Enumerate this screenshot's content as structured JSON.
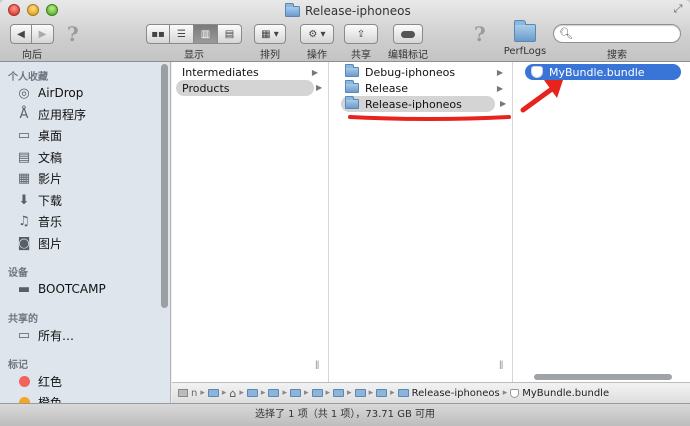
{
  "window": {
    "title": "Release-iphoneos"
  },
  "toolbar": {
    "back_label": "向后",
    "view_label": "显示",
    "arrange_label": "排列",
    "action_label": "操作",
    "share_label": "共享",
    "edit_tags_label": "编辑标记",
    "perflogs_label": "PerfLogs",
    "search_label": "搜索",
    "search_placeholder": ""
  },
  "sidebar": {
    "favorites_header": "个人收藏",
    "favorites": [
      {
        "label": "AirDrop",
        "icon": "airdrop-icon"
      },
      {
        "label": "应用程序",
        "icon": "applications-icon"
      },
      {
        "label": "桌面",
        "icon": "desktop-icon"
      },
      {
        "label": "文稿",
        "icon": "documents-icon"
      },
      {
        "label": "影片",
        "icon": "movies-icon"
      },
      {
        "label": "下载",
        "icon": "downloads-icon"
      },
      {
        "label": "音乐",
        "icon": "music-icon"
      },
      {
        "label": "图片",
        "icon": "pictures-icon"
      }
    ],
    "devices_header": "设备",
    "devices": [
      {
        "label": "BOOTCAMP",
        "icon": "drive-icon"
      }
    ],
    "shared_header": "共享的",
    "shared": [
      {
        "label": "所有…",
        "icon": "network-icon"
      }
    ],
    "tags_header": "标记",
    "tags": [
      {
        "label": "红色",
        "color": "#f2625e"
      },
      {
        "label": "橙色",
        "color": "#f5a623"
      }
    ]
  },
  "columns": [
    {
      "items": [
        "Intermediates",
        "Products"
      ],
      "selected": "Products"
    },
    {
      "items": [
        "Debug-iphoneos",
        "Release",
        "Release-iphoneos"
      ],
      "selected": "Release-iphoneos"
    },
    {
      "items": [
        "MyBundle.bundle"
      ],
      "selected": "MyBundle.bundle"
    }
  ],
  "pathbar": {
    "folder_label": "Release-iphoneos",
    "bundle_label": "MyBundle.bundle",
    "drive_short": "n"
  },
  "status": {
    "text": "选择了 1 项（共 1 项），73.71 GB 可用"
  },
  "colors": {
    "selection_blue": "#3875d7",
    "annotation_red": "#e8231b"
  }
}
